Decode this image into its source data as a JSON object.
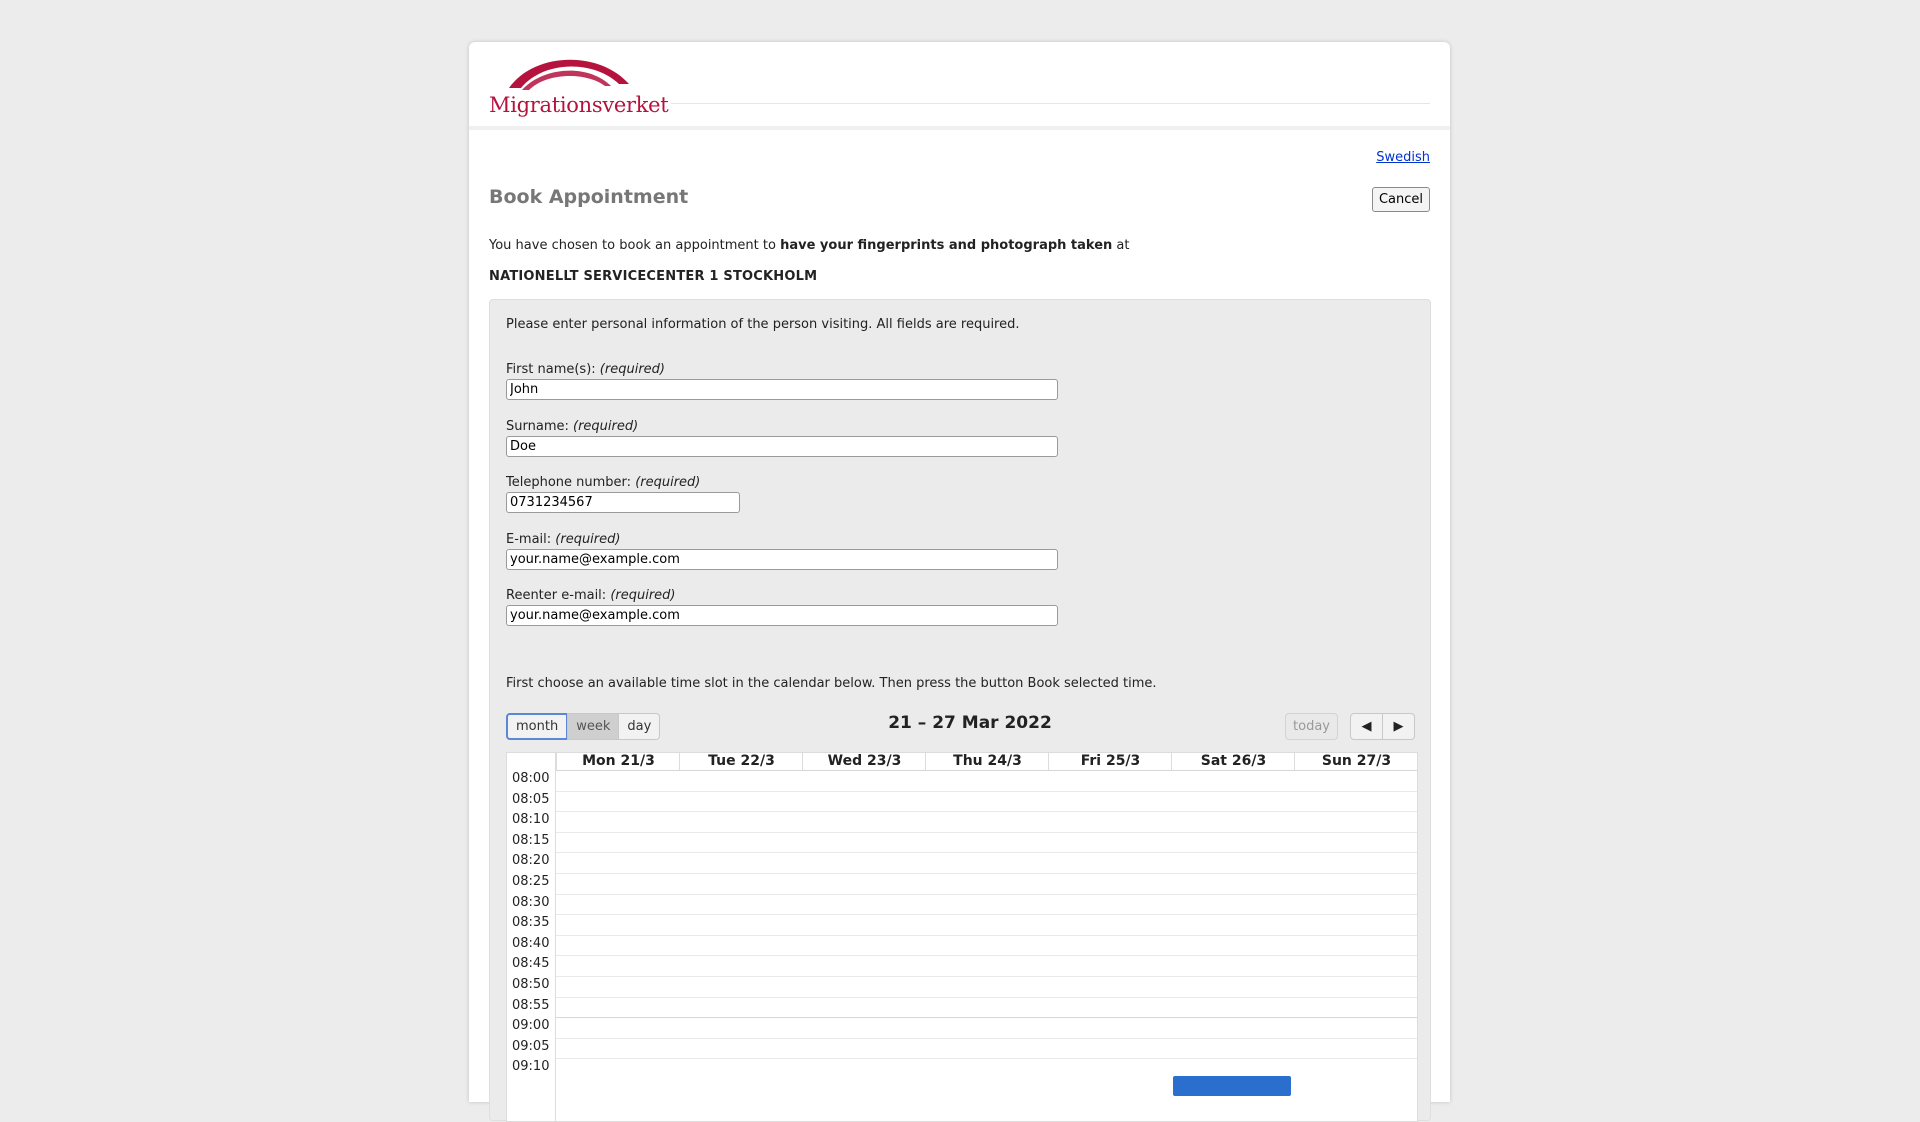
{
  "header": {
    "brand_name": "Migrationsverket",
    "brand_color": "#b5123e"
  },
  "language_link": "Swedish",
  "page_title": "Book Appointment",
  "cancel_label": "Cancel",
  "intro": {
    "prefix": "You have chosen to book an appointment to ",
    "purpose": "have your fingerprints and photograph taken",
    "suffix": " at"
  },
  "location": "NATIONELLT SERVICECENTER 1 STOCKHOLM",
  "form": {
    "instruction": "Please enter personal information of the person visiting. All fields are required.",
    "required_tag": "(required)",
    "fields": {
      "first_name": {
        "label": "First name(s): ",
        "value": "John"
      },
      "surname": {
        "label": "Surname: ",
        "value": "Doe"
      },
      "telephone": {
        "label": "Telephone number: ",
        "value": "0731234567"
      },
      "email": {
        "label": "E-mail: ",
        "value": "your.name@example.com"
      },
      "email_confirm": {
        "label": "Reenter e-mail: ",
        "value": "your.name@example.com"
      }
    }
  },
  "calendar": {
    "instruction": "First choose an available time slot in the calendar below. Then press the button Book selected time.",
    "views": [
      "month",
      "week",
      "day"
    ],
    "active_view": "week",
    "focused_view": "month",
    "title": "21 – 27 Mar 2022",
    "today_label": "today",
    "prev_icon": "◀",
    "next_icon": "▶",
    "days": [
      "Mon 21/3",
      "Tue 22/3",
      "Wed 23/3",
      "Thu 24/3",
      "Fri 25/3",
      "Sat 26/3",
      "Sun 27/3"
    ],
    "time_slots": [
      "08:00",
      "08:05",
      "08:10",
      "08:15",
      "08:20",
      "08:25",
      "08:30",
      "08:35",
      "08:40",
      "08:45",
      "08:50",
      "08:55",
      "09:00",
      "09:05",
      "09:10"
    ],
    "event_color": "#2a6fce"
  }
}
